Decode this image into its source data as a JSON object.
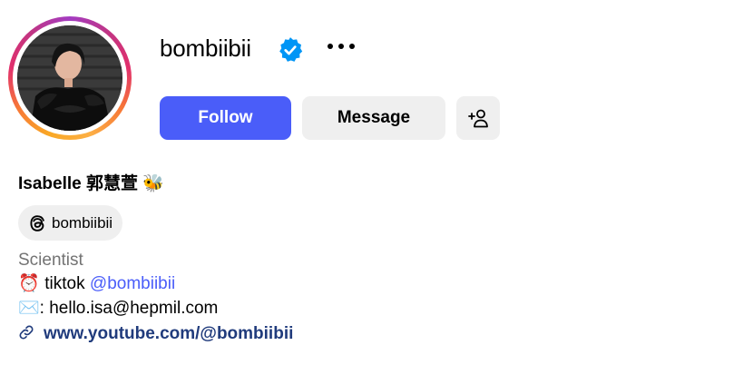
{
  "profile": {
    "username": "bombiibii",
    "verified_icon": "verified-badge-icon",
    "more_icon": "more-horizontal-icon",
    "full_name": "Isabelle 郭慧萱 🐝",
    "threads_handle": "bombiibii",
    "category": "Scientist"
  },
  "actions": {
    "follow_label": "Follow",
    "message_label": "Message",
    "add_user_icon": "add-user-icon"
  },
  "bio": {
    "line1_emoji": "⏰",
    "line1_text": " tiktok ",
    "line1_mention": "@bombiibii",
    "line2_emoji": "✉️",
    "line2_text": ": hello.isa@hepmil.com",
    "link_icon": "link-icon",
    "link_text": "www.youtube.com/@bombiibii"
  },
  "colors": {
    "primary_button": "#4a5df9",
    "secondary_button": "#efefef",
    "verified_badge": "#0095f6",
    "mention": "#4a5df9",
    "link": "#203b7c",
    "category_text": "#737373"
  }
}
